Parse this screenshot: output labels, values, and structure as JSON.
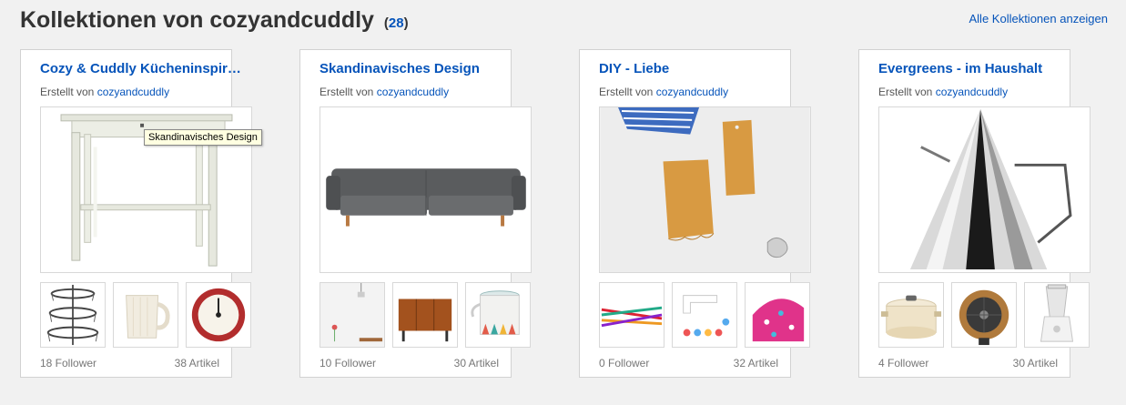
{
  "header": {
    "title": "Kollektionen von cozyandcuddly",
    "count": "28",
    "view_all": "Alle Kollektionen anzeigen"
  },
  "creator_prefix": "Erstellt von",
  "tooltip": "Skandinavisches Design",
  "collections": [
    {
      "title": "Cozy & Cuddly Kücheninspir…",
      "creator": "cozyandcuddly",
      "main_image": "white-wooden-side-table",
      "thumbnails": [
        "wire-basket-stand",
        "white-ribbed-mug",
        "kitchen-timer"
      ],
      "followers": "18 Follower",
      "items": "38 Artikel"
    },
    {
      "title": "Skandinavisches Design",
      "creator": "cozyandcuddly",
      "main_image": "grey-sofa",
      "thumbnails": [
        "pendant-lamp-room",
        "teak-sideboard",
        "teapot-triangle-pattern"
      ],
      "followers": "10 Follower",
      "items": "30 Artikel"
    },
    {
      "title": "DIY - Liebe",
      "creator": "cozyandcuddly",
      "main_image": "handmade-kraft-tags",
      "thumbnails": [
        "knitting-needles",
        "sewing-machine-cupcakes",
        "floral-fabric"
      ],
      "followers": "0 Follower",
      "items": "32 Artikel"
    },
    {
      "title": "Evergreens - im Haushalt",
      "creator": "cozyandcuddly",
      "main_image": "chrome-cone-kettle",
      "thumbnails": [
        "cream-cast-iron-pot",
        "copper-fan-heater",
        "white-blender"
      ],
      "followers": "4 Follower",
      "items": "30 Artikel"
    }
  ]
}
